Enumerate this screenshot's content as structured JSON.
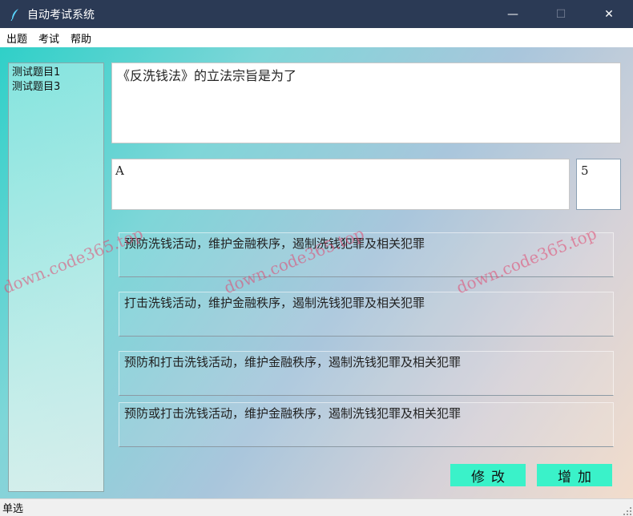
{
  "window": {
    "title": "自动考试系统",
    "minimize": "—",
    "maximize": "☐",
    "close": "✕"
  },
  "menu": {
    "items": [
      "出题",
      "考试",
      "帮助"
    ]
  },
  "sidebar": {
    "items": [
      "测试题目1",
      "测试题目3"
    ]
  },
  "question": {
    "text": "《反洗钱法》的立法宗旨是为了",
    "answer": "A",
    "score": "5",
    "options": [
      "预防洗钱活动，维护金融秩序，遏制洗钱犯罪及相关犯罪",
      "打击洗钱活动，维护金融秩序，遏制洗钱犯罪及相关犯罪",
      "预防和打击洗钱活动，维护金融秩序，遏制洗钱犯罪及相关犯罪",
      "预防或打击洗钱活动，维护金融秩序，遏制洗钱犯罪及相关犯罪"
    ]
  },
  "buttons": {
    "modify": "修改",
    "add": "增加"
  },
  "watermark": "down.code365.top",
  "status": {
    "text": "单选"
  },
  "icons": {
    "app": "feather-icon",
    "grip": "resize-grip-icon"
  },
  "colors": {
    "titlebar": "#2b3a55",
    "button": "#3af2c9"
  }
}
